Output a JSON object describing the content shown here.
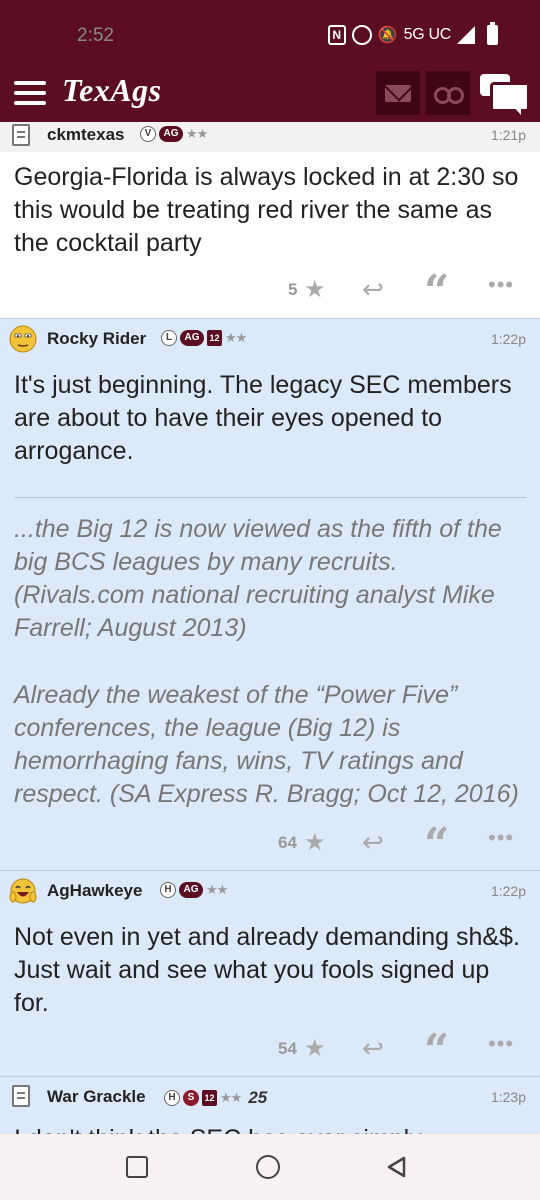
{
  "status_bar": {
    "time": "2:52",
    "network": "5G UC",
    "icons": [
      "nfc-icon",
      "alarm-icon",
      "dnd-off-icon",
      "signal-icon",
      "battery-icon"
    ]
  },
  "header": {
    "logo": "TexAgs",
    "icons": [
      "menu-icon",
      "mail-icon",
      "binoculars-icon",
      "chat-icon"
    ]
  },
  "posts": [
    {
      "user": "ckmtexas",
      "badges": [
        "V",
        "AG",
        "★★"
      ],
      "time": "1:21p",
      "body": "Georgia-Florida is always locked in at 2:30 so this would be treating red river the same as the cocktail party",
      "stars": "5"
    },
    {
      "user": "Rocky Rider",
      "badges": [
        "L",
        "AG",
        "12",
        "★★"
      ],
      "time": "1:22p",
      "body": "It's just beginning. The legacy SEC members are about to have their eyes opened to arrogance.",
      "quote_1": "...the Big 12 is now viewed as the fifth of the big BCS leagues by many recruits. (Rivals.com national recruiting analyst Mike Farrell; August 2013)",
      "quote_2": "Already the weakest of the “Power Five” conferences, the league (Big 12) is hemorrhaging fans, wins, TV ratings and respect. (SA Express R. Bragg; Oct 12, 2016)",
      "stars": "64"
    },
    {
      "user": "AgHawkeye",
      "badges": [
        "H",
        "AG",
        "★★"
      ],
      "time": "1:22p",
      "body": "Not even in yet and already demanding sh&$. Just wait and see what you fools signed up for.",
      "stars": "54"
    },
    {
      "user": "War Grackle",
      "badges": [
        "H",
        "S",
        "12",
        "★★",
        "25"
      ],
      "time": "1:23p",
      "body": "I don't think the SEC has ever simply"
    }
  ],
  "actions": {
    "star": "★",
    "reply": "↩",
    "quote": "“",
    "more": "•••"
  },
  "colors": {
    "maroon": "#5b0e22",
    "post_blue": "#dce9f8",
    "muted": "#999999"
  }
}
